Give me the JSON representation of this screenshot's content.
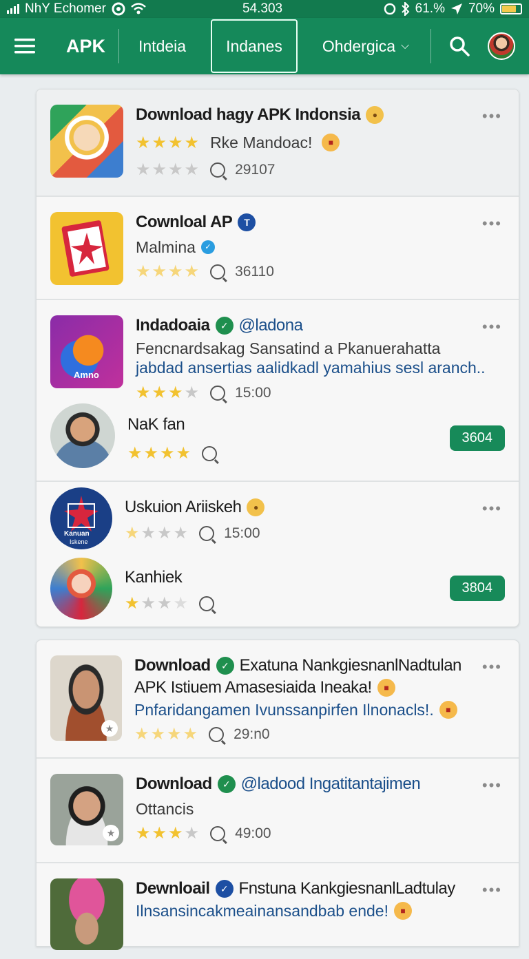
{
  "status": {
    "carrier": "NhY Echomer",
    "time": "54.303",
    "battery_pct_text": "61.% ",
    "battery": "70%",
    "battery_level": 0.7
  },
  "nav": {
    "brand": "APK",
    "tabs": [
      {
        "label": "Intdeia"
      },
      {
        "label": "Indanes"
      },
      {
        "label": "Ohdergica"
      }
    ]
  },
  "card1": [
    {
      "title": "Download hagy APK Indonsia",
      "sub": "Rke Mandoac!",
      "stars_on": 4,
      "count": "29107"
    },
    {
      "title": "Cownloal AP",
      "sub": "Malmina",
      "stars_on": 4,
      "count": "36110"
    },
    {
      "title": "Indadoaia",
      "handle": "@ladona",
      "sub1": "Fencnardsakag Sansatind a Pkanuerahatta",
      "sub2": "jabdad ansertias aalidkadl yamahius sesl aranch..",
      "stars_on": 3,
      "count": "15:00",
      "thumb_label": "Amno"
    },
    {
      "title": "NaK fan",
      "stars_on": 4,
      "badge": "3604"
    },
    {
      "title": "Uskuion Ariiskeh",
      "stars_on": 1,
      "count": "15:00",
      "thumb_label_1": "Kanuan",
      "thumb_label_2": "Iskene"
    },
    {
      "title": "Kanhiek",
      "stars_on": 1,
      "badge": "3804"
    }
  ],
  "card2": [
    {
      "title": "Download",
      "title2": "Exatuna NankgiesnanlNadtulan",
      "title_line2": "APK Istiuem Amasesiaida Ineaka!",
      "sub": "Pnfaridangamen Ivunssanpirfen Ilnonacls!.",
      "stars_on": 4,
      "count": "29:n0"
    },
    {
      "title": "Download",
      "handle": "@ladood Ingatitantajimen",
      "sub": "Ottancis",
      "stars_on": 3,
      "count": "49:00"
    },
    {
      "title": "Dewnloail",
      "title2": "Fnstuna KankgiesnanlLadtulay",
      "sub": "Ilnsansincakmeainansandbab ende!"
    }
  ]
}
